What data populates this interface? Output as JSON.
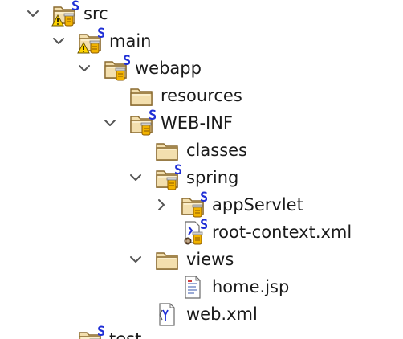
{
  "tree": {
    "nodes": [
      {
        "label": "src",
        "depth": 0,
        "expander": "expanded",
        "icon": "source-folder-warning-icon"
      },
      {
        "label": "main",
        "depth": 1,
        "expander": "expanded",
        "icon": "source-folder-warning-icon"
      },
      {
        "label": "webapp",
        "depth": 2,
        "expander": "expanded",
        "icon": "source-folder-icon"
      },
      {
        "label": "resources",
        "depth": 3,
        "expander": "none",
        "icon": "folder-icon"
      },
      {
        "label": "WEB-INF",
        "depth": 3,
        "expander": "expanded",
        "icon": "source-folder-icon"
      },
      {
        "label": "classes",
        "depth": 4,
        "expander": "none",
        "icon": "folder-icon"
      },
      {
        "label": "spring",
        "depth": 4,
        "expander": "expanded",
        "icon": "source-folder-icon"
      },
      {
        "label": "appServlet",
        "depth": 5,
        "expander": "collapsed",
        "icon": "source-folder-icon"
      },
      {
        "label": "root-context.xml",
        "depth": 5,
        "expander": "none",
        "icon": "spring-xml-file-icon"
      },
      {
        "label": "views",
        "depth": 4,
        "expander": "expanded",
        "icon": "folder-icon"
      },
      {
        "label": "home.jsp",
        "depth": 5,
        "expander": "none",
        "icon": "jsp-file-icon"
      },
      {
        "label": "web.xml",
        "depth": 4,
        "expander": "none",
        "icon": "xml-file-icon"
      }
    ],
    "partial": {
      "label": "test",
      "icon": "source-folder-icon"
    },
    "overlay_letter": "S",
    "colors": {
      "folder_fill": "#f3dfae",
      "folder_stroke": "#8a6a2e",
      "overlay_blue": "#1f2fd6",
      "warning_yellow": "#ffd400",
      "chevron": "#555555",
      "text": "#1a1a1a"
    }
  }
}
